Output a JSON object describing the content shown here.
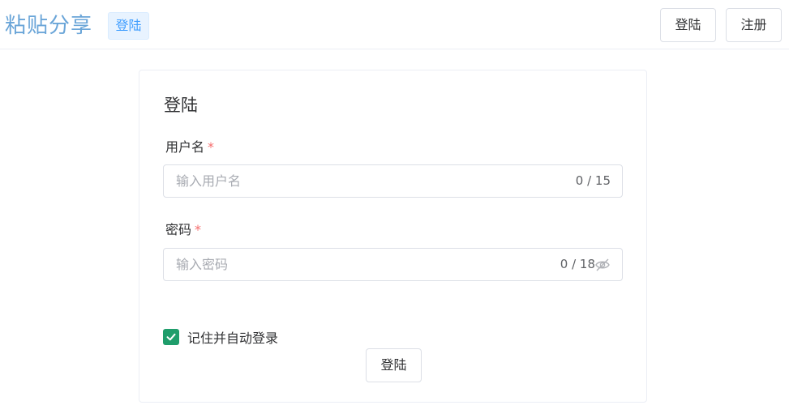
{
  "header": {
    "brand": "粘贴分享",
    "tag": "登陆",
    "login_button": "登陆",
    "register_button": "注册"
  },
  "login_card": {
    "title": "登陆",
    "username": {
      "label": "用户名",
      "required_mark": "*",
      "placeholder": "输入用户名",
      "count": "0 / 15"
    },
    "password": {
      "label": "密码",
      "required_mark": "*",
      "placeholder": "输入密码",
      "count": "0 / 18"
    },
    "remember": {
      "label": "记住并自动登录",
      "checked": true
    },
    "submit_label": "登陆"
  },
  "colors": {
    "brand": "#6aa5d8",
    "tag_bg": "#e8f3ff",
    "checkbox": "#1f9d6b",
    "required": "#f56c6c",
    "placeholder": "#a8abb2"
  }
}
